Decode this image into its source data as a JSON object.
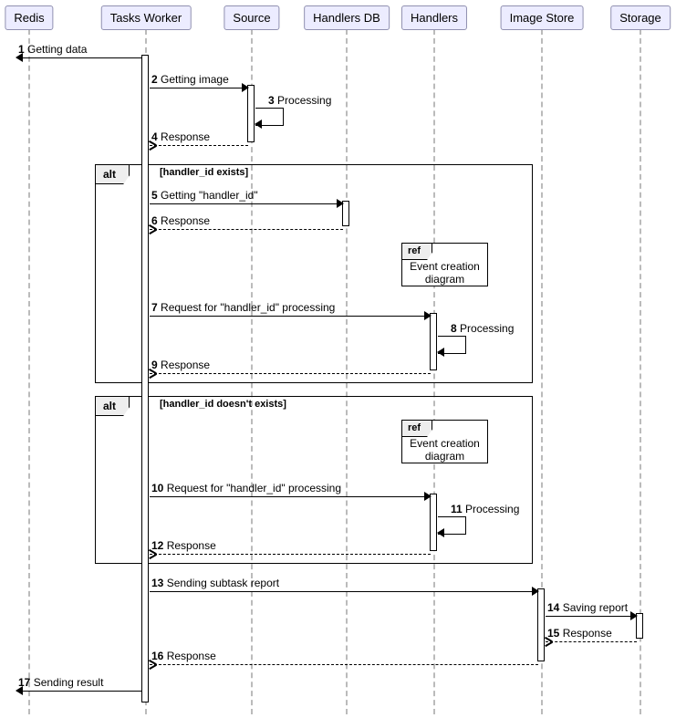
{
  "participants": {
    "redis": "Redis",
    "worker": "Tasks Worker",
    "source": "Source",
    "hdb": "Handlers DB",
    "handlers": "Handlers",
    "imgstore": "Image Store",
    "storage": "Storage"
  },
  "frames": {
    "alt1": {
      "tag": "alt",
      "guard": "[handler_id exists]"
    },
    "alt2": {
      "tag": "alt",
      "guard": "[handler_id doesn't exists]"
    }
  },
  "refs": {
    "ref1": {
      "tag": "ref",
      "text": "Event creation diagram"
    },
    "ref2": {
      "tag": "ref",
      "text": "Event creation diagram"
    }
  },
  "messages": {
    "m1": {
      "n": "1",
      "t": "Getting data"
    },
    "m2": {
      "n": "2",
      "t": "Getting image"
    },
    "m3": {
      "n": "3",
      "t": "Processing"
    },
    "m4": {
      "n": "4",
      "t": "Response"
    },
    "m5": {
      "n": "5",
      "t": "Getting \"handler_id\""
    },
    "m6": {
      "n": "6",
      "t": "Response"
    },
    "m7": {
      "n": "7",
      "t": "Request for \"handler_id\" processing"
    },
    "m8": {
      "n": "8",
      "t": "Processing"
    },
    "m9": {
      "n": "9",
      "t": "Response"
    },
    "m10": {
      "n": "10",
      "t": "Request for \"handler_id\" processing"
    },
    "m11": {
      "n": "11",
      "t": "Processing"
    },
    "m12": {
      "n": "12",
      "t": "Response"
    },
    "m13": {
      "n": "13",
      "t": "Sending subtask report"
    },
    "m14": {
      "n": "14",
      "t": "Saving report"
    },
    "m15": {
      "n": "15",
      "t": "Response"
    },
    "m16": {
      "n": "16",
      "t": "Response"
    },
    "m17": {
      "n": "17",
      "t": "Sending result"
    }
  },
  "chart_data": {
    "type": "sequence-diagram",
    "participants": [
      "Redis",
      "Tasks Worker",
      "Source",
      "Handlers DB",
      "Handlers",
      "Image Store",
      "Storage"
    ],
    "messages": [
      {
        "n": 1,
        "from": "Tasks Worker",
        "to": "Redis",
        "label": "Getting data",
        "style": "sync"
      },
      {
        "n": 2,
        "from": "Tasks Worker",
        "to": "Source",
        "label": "Getting image",
        "style": "sync"
      },
      {
        "n": 3,
        "from": "Source",
        "to": "Source",
        "label": "Processing",
        "style": "self"
      },
      {
        "n": 4,
        "from": "Source",
        "to": "Tasks Worker",
        "label": "Response",
        "style": "return"
      },
      {
        "n": 5,
        "from": "Tasks Worker",
        "to": "Handlers DB",
        "label": "Getting \"handler_id\"",
        "style": "sync",
        "frame": "alt1"
      },
      {
        "n": 6,
        "from": "Handlers DB",
        "to": "Tasks Worker",
        "label": "Response",
        "style": "return",
        "frame": "alt1"
      },
      {
        "n": 7,
        "from": "Tasks Worker",
        "to": "Handlers",
        "label": "Request for \"handler_id\" processing",
        "style": "sync",
        "frame": "alt1"
      },
      {
        "n": 8,
        "from": "Handlers",
        "to": "Handlers",
        "label": "Processing",
        "style": "self",
        "frame": "alt1"
      },
      {
        "n": 9,
        "from": "Handlers",
        "to": "Tasks Worker",
        "label": "Response",
        "style": "return",
        "frame": "alt1"
      },
      {
        "n": 10,
        "from": "Tasks Worker",
        "to": "Handlers",
        "label": "Request for \"handler_id\" processing",
        "style": "sync",
        "frame": "alt2"
      },
      {
        "n": 11,
        "from": "Handlers",
        "to": "Handlers",
        "label": "Processing",
        "style": "self",
        "frame": "alt2"
      },
      {
        "n": 12,
        "from": "Handlers",
        "to": "Tasks Worker",
        "label": "Response",
        "style": "return",
        "frame": "alt2"
      },
      {
        "n": 13,
        "from": "Tasks Worker",
        "to": "Image Store",
        "label": "Sending subtask report",
        "style": "sync"
      },
      {
        "n": 14,
        "from": "Image Store",
        "to": "Storage",
        "label": "Saving report",
        "style": "sync"
      },
      {
        "n": 15,
        "from": "Storage",
        "to": "Image Store",
        "label": "Response",
        "style": "return"
      },
      {
        "n": 16,
        "from": "Image Store",
        "to": "Tasks Worker",
        "label": "Response",
        "style": "return"
      },
      {
        "n": 17,
        "from": "Tasks Worker",
        "to": "Redis",
        "label": "Sending result",
        "style": "sync"
      }
    ],
    "frames": [
      {
        "id": "alt1",
        "type": "alt",
        "guard": "handler_id exists",
        "contains_ref": "Event creation diagram"
      },
      {
        "id": "alt2",
        "type": "alt",
        "guard": "handler_id doesn't exists",
        "contains_ref": "Event creation diagram"
      }
    ]
  }
}
